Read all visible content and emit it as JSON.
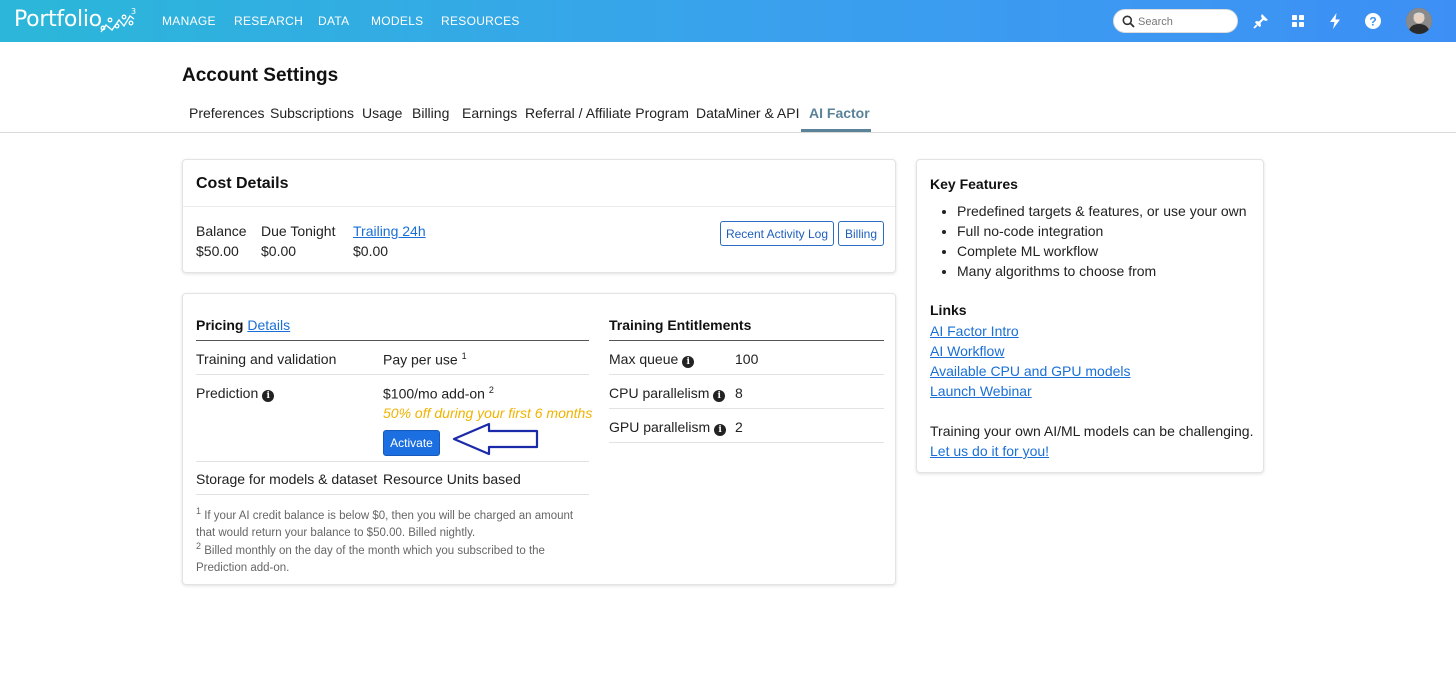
{
  "topbar": {
    "logo_text": "Portfolio",
    "nav": [
      "MANAGE",
      "RESEARCH",
      "DATA",
      "MODELS",
      "RESOURCES"
    ],
    "search_placeholder": "Search",
    "icons": [
      "pin-icon",
      "grid-icon",
      "lightning-icon",
      "help-icon",
      "user-avatar"
    ]
  },
  "page": {
    "title": "Account Settings",
    "tabs": [
      "Preferences",
      "Subscriptions",
      "Usage",
      "Billing",
      "Earnings",
      "Referral / Affiliate Program",
      "DataMiner & API",
      "AI Factor"
    ],
    "active_tab": "AI Factor"
  },
  "cost": {
    "title": "Cost Details",
    "balance_label": "Balance",
    "balance_value": "$50.00",
    "due_label": "Due Tonight",
    "due_value": "$0.00",
    "trailing_label": "Trailing 24h",
    "trailing_value": "$0.00",
    "activity_button": "Recent Activity Log",
    "billing_button": "Billing"
  },
  "pricing": {
    "title": "Pricing",
    "details_link": "Details",
    "rows": [
      {
        "label": "Training and validation",
        "value": "Pay per use",
        "sup": "1"
      },
      {
        "label": "Prediction",
        "value": "$100/mo add-on",
        "sup": "2",
        "promo": "50% off during your first 6 months",
        "button": "Activate"
      },
      {
        "label": "Storage for models & dataset",
        "value": "Resource Units based"
      }
    ],
    "footnotes": [
      {
        "mark": "1",
        "text_line1": "If your AI credit balance is below $0, then you will be charged an amount",
        "text_line2": "that would return your balance to $50.00. Billed nightly."
      },
      {
        "mark": "2",
        "text_line1": "Billed monthly on the day of the month which you subscribed to the",
        "text_line2": "Prediction add-on."
      }
    ]
  },
  "training": {
    "title": "Training Entitlements",
    "rows": [
      {
        "label": "Max queue",
        "value": "100"
      },
      {
        "label": "CPU parallelism",
        "value": "8"
      },
      {
        "label": "GPU parallelism",
        "value": "2"
      }
    ]
  },
  "side": {
    "features_title": "Key Features",
    "features": [
      "Predefined targets & features, or use your own",
      "Full no-code integration",
      "Complete ML workflow",
      "Many algorithms to choose from"
    ],
    "links_title": "Links",
    "links": [
      "AI Factor Intro",
      "AI Workflow",
      "Available CPU and GPU models",
      "Launch Webinar"
    ],
    "cta_text": "Training your own AI/ML models can be challenging.",
    "cta_link": "Let us do it for you!"
  },
  "colors": {
    "topbar_start": "#2bb7d9",
    "topbar_end": "#3d8ff5",
    "active_tab": "#5a8299",
    "link": "#1a6fd6",
    "primary_button": "#1c6fe0",
    "promo": "#f0b300",
    "arrow": "#1a2aa8"
  }
}
